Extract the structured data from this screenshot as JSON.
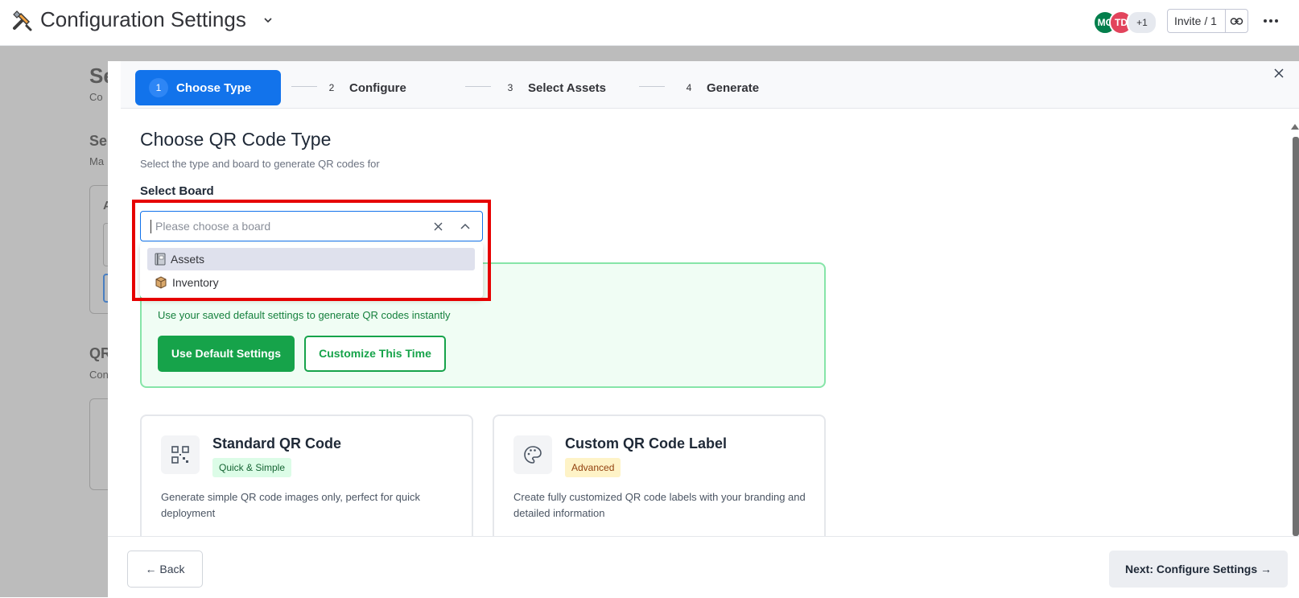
{
  "header": {
    "title": "Configuration Settings",
    "avatars": [
      "MC",
      "TD",
      "+1"
    ],
    "invite_label": "Invite / 1"
  },
  "background_fragments": [
    "Se",
    "Co",
    "Se",
    "Ma",
    "A",
    "QR",
    "Con"
  ],
  "stepper": {
    "steps": [
      {
        "num": "1",
        "label": "Choose Type"
      },
      {
        "num": "2",
        "label": "Configure"
      },
      {
        "num": "3",
        "label": "Select Assets"
      },
      {
        "num": "4",
        "label": "Generate"
      }
    ],
    "active": 1
  },
  "main": {
    "title": "Choose QR Code Type",
    "subtitle": "Select the type and board to generate QR codes for",
    "board_label": "Select Board",
    "board_placeholder": "Please choose a board",
    "board_options": [
      "Assets",
      "Inventory"
    ]
  },
  "defaults_panel": {
    "description": "Use your saved default settings to generate QR codes instantly",
    "use_default": "Use Default Settings",
    "customize": "Customize This Time"
  },
  "cards": [
    {
      "title": "Standard QR Code",
      "badge": "Quick & Simple",
      "description": "Generate simple QR code images only, perfect for quick deployment",
      "icon": "qr-code-icon"
    },
    {
      "title": "Custom QR Code Label",
      "badge": "Advanced",
      "description": "Create fully customized QR code labels with your branding and detailed information",
      "icon": "palette-icon"
    }
  ],
  "footer": {
    "back": "← Back",
    "next": "Next: Configure Settings →"
  },
  "colors": {
    "primary": "#1273eb",
    "success": "#16a34a",
    "highlight": "#e60000"
  }
}
